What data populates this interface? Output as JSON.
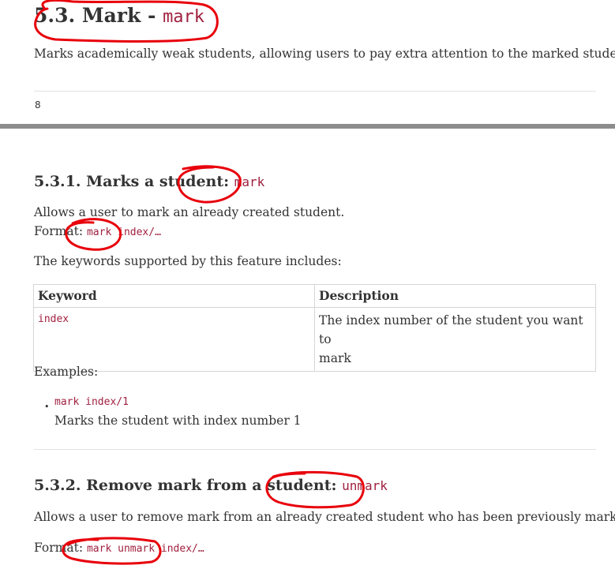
{
  "section": {
    "title_prefix": "5.3. Mark - ",
    "title_code": "mark",
    "description": "Marks academically weak students, allowing users to pay extra attention to the marked students."
  },
  "page_number": "8",
  "subsection_1": {
    "title_prefix": "5.3.1. Marks a student: ",
    "title_code": "mark",
    "description": "Allows a user to mark an already created student.",
    "format_label": "Format:",
    "format_code": "mark index/…",
    "keywords_intro": "The keywords supported by this feature includes:",
    "table": {
      "headers": [
        "Keyword",
        "Description"
      ],
      "rows": [
        {
          "keyword": "index",
          "description_line1": "The index number of the student you want to",
          "description_line2": "mark"
        }
      ]
    },
    "examples_label": "Examples:",
    "examples": [
      {
        "code": "mark index/1",
        "text": "Marks the student with index number 1"
      }
    ]
  },
  "subsection_2": {
    "title_prefix": "5.3.2. Remove mark from a student: ",
    "title_code": "unmark",
    "description": "Allows a user to remove mark from an already created student who has been previously marked.",
    "format_label": "Format:",
    "format_code": "mark unmark index/…"
  },
  "annotation_color": "#e8000b"
}
